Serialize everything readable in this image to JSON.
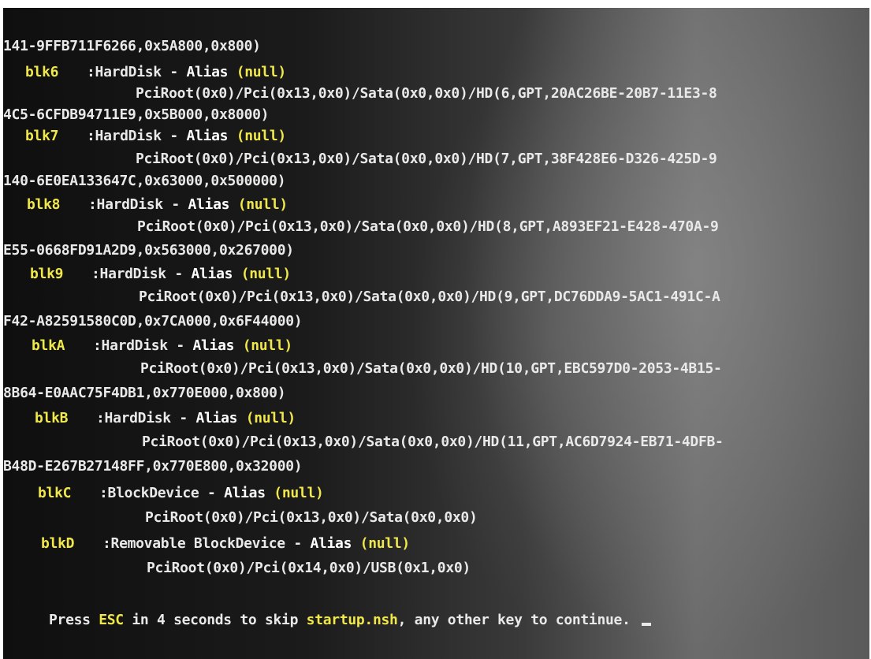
{
  "lines": [
    {
      "text": "141-9FFB711F6266,0x5A800,0x800)"
    },
    {
      "dev": "blk6",
      "desc": ":HardDisk - ",
      "alias": "Alias",
      "null": "(null)"
    },
    {
      "text": "PciRoot(0x0)/Pci(0x13,0x0)/Sata(0x0,0x0)/HD(6,GPT,20AC26BE-20B7-11E3-8"
    },
    {
      "text": "4C5-6CFDB94711E9,0x5B000,0x8000)"
    },
    {
      "dev": "blk7",
      "desc": ":HardDisk - ",
      "alias": "Alias",
      "null": "(null)"
    },
    {
      "text": "PciRoot(0x0)/Pci(0x13,0x0)/Sata(0x0,0x0)/HD(7,GPT,38F428E6-D326-425D-9"
    },
    {
      "text": "140-6E0EA133647C,0x63000,0x500000)"
    },
    {
      "dev": "blk8",
      "desc": ":HardDisk - ",
      "alias": "Alias",
      "null": "(null)"
    },
    {
      "text": "PciRoot(0x0)/Pci(0x13,0x0)/Sata(0x0,0x0)/HD(8,GPT,A893EF21-E428-470A-9"
    },
    {
      "text": "E55-0668FD91A2D9,0x563000,0x267000)"
    },
    {
      "dev": "blk9",
      "desc": ":HardDisk - ",
      "alias": "Alias",
      "null": "(null)"
    },
    {
      "text": "PciRoot(0x0)/Pci(0x13,0x0)/Sata(0x0,0x0)/HD(9,GPT,DC76DDA9-5AC1-491C-A"
    },
    {
      "text": "F42-A82591580C0D,0x7CA000,0x6F44000)"
    },
    {
      "dev": "blkA",
      "desc": ":HardDisk - ",
      "alias": "Alias",
      "null": "(null)"
    },
    {
      "text": "PciRoot(0x0)/Pci(0x13,0x0)/Sata(0x0,0x0)/HD(10,GPT,EBC597D0-2053-4B15-"
    },
    {
      "text": "8B64-E0AAC75F4DB1,0x770E000,0x800)"
    },
    {
      "dev": "blkB",
      "desc": ":HardDisk - ",
      "alias": "Alias",
      "null": "(null)"
    },
    {
      "text": "PciRoot(0x0)/Pci(0x13,0x0)/Sata(0x0,0x0)/HD(11,GPT,AC6D7924-EB71-4DFB-"
    },
    {
      "text": "B48D-E267B27148FF,0x770E800,0x32000)"
    },
    {
      "dev": "blkC",
      "desc": ":BlockDevice - ",
      "alias": "Alias",
      "null": "(null)"
    },
    {
      "text": "PciRoot(0x0)/Pci(0x13,0x0)/Sata(0x0,0x0)"
    },
    {
      "dev": "blkD",
      "desc": ":Removable BlockDevice - ",
      "alias": "Alias",
      "null": "(null)"
    },
    {
      "text": "PciRoot(0x0)/Pci(0x14,0x0)/USB(0x1,0x0)"
    }
  ],
  "prompt": {
    "p1": "Press ",
    "esc": "ESC",
    "p2": " in 4 seconds to skip ",
    "file": "startup.nsh",
    "p3": ", any other key to continue. "
  }
}
